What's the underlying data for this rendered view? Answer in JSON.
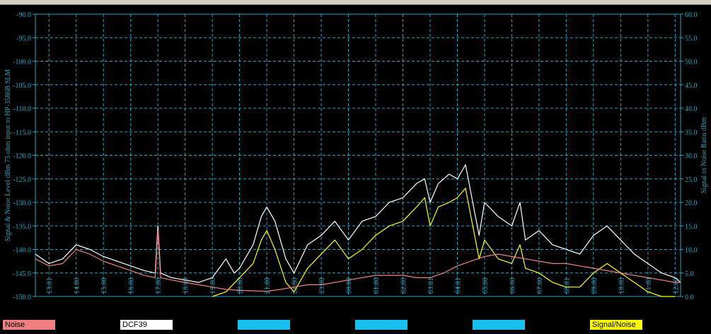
{
  "colors": {
    "background": "#000000",
    "axis": "#20a8c8",
    "grid": "#20a8c8",
    "noise": "#f08080",
    "signal": "#ffffff",
    "snr": "#ffff00",
    "blue_swatch": "#18c0f0"
  },
  "legend": {
    "noise": "Noise",
    "signal": "DCF39",
    "snr": "Signal/Noise",
    "blank1": "",
    "blank2": "",
    "blank3": ""
  },
  "chart_data": {
    "type": "line",
    "ylabel_left": "Signal & Noise Level  dBm 75 ohm input to HP-3586B SLM",
    "ylabel_right": "Signal to Noise Ratio  dBm",
    "ylim_left": [
      -150,
      -90
    ],
    "ylim_right": [
      0,
      60
    ],
    "yticks_left": [
      "-90.0",
      "-95.0",
      "-100.0",
      "-105.0",
      "-110.0",
      "-115.0",
      "-120.0",
      "-125.0",
      "-130.0",
      "-135.0",
      "-140.0",
      "-145.0",
      "-150.0"
    ],
    "yticks_right": [
      "60.0",
      "55.0",
      "50.0",
      "45.0",
      "40.0",
      "35.0",
      "30.0",
      "25.0",
      "20.0",
      "15.0",
      "10.0",
      "5.0",
      "0.0"
    ],
    "xlim": [
      12.5,
      36.2
    ],
    "xticks": [
      {
        "x": 13,
        "label": "13:01"
      },
      {
        "x": 14,
        "label": "14:00"
      },
      {
        "x": 15,
        "label": "15:00"
      },
      {
        "x": 16,
        "label": "16:00"
      },
      {
        "x": 17,
        "label": "17:00"
      },
      {
        "x": 18,
        "label": "18:00"
      },
      {
        "x": 19,
        "label": "19:00"
      },
      {
        "x": 20,
        "label": "20:00"
      },
      {
        "x": 21,
        "label": "21:00"
      },
      {
        "x": 22,
        "label": "22:00"
      },
      {
        "x": 23,
        "label": "23:00"
      },
      {
        "x": 24,
        "label": "00:00"
      },
      {
        "x": 25,
        "label": "01:00"
      },
      {
        "x": 26,
        "label": "02:00"
      },
      {
        "x": 27,
        "label": "03:01"
      },
      {
        "x": 28,
        "label": "04:01"
      },
      {
        "x": 29,
        "label": "05:00"
      },
      {
        "x": 30,
        "label": "06:00"
      },
      {
        "x": 31,
        "label": "07:00"
      },
      {
        "x": 32,
        "label": "08:01"
      },
      {
        "x": 33,
        "label": "09:00"
      },
      {
        "x": 34,
        "label": "10:00"
      },
      {
        "x": 35,
        "label": "11:00"
      },
      {
        "x": 36,
        "label": "12:00"
      }
    ],
    "grid": true,
    "series": [
      {
        "name": "Noise",
        "axis": "left",
        "x": [
          12.5,
          13,
          13.5,
          14,
          14.5,
          15,
          15.5,
          16,
          16.5,
          16.9,
          17,
          17.1,
          17.5,
          18,
          18.5,
          19,
          19.5,
          20,
          20.5,
          21,
          21.5,
          22,
          22.5,
          23,
          23.5,
          24,
          24.5,
          25,
          25.5,
          26,
          26.5,
          27,
          27.5,
          28,
          28.5,
          29,
          29.5,
          30,
          30.5,
          31,
          31.5,
          32,
          32.5,
          33,
          33.5,
          34,
          34.5,
          35,
          35.5,
          36,
          36.2
        ],
        "y": [
          -142,
          -143.5,
          -143,
          -140,
          -141,
          -142.5,
          -143.5,
          -144.5,
          -145.5,
          -146,
          -136,
          -146,
          -146.5,
          -147,
          -147.5,
          -148,
          -148.5,
          -148.7,
          -148.8,
          -148.9,
          -148.5,
          -148,
          -147.5,
          -147.5,
          -147,
          -146.5,
          -146,
          -145.5,
          -145.5,
          -145.5,
          -146,
          -146,
          -145,
          -143.5,
          -142.5,
          -141.5,
          -141,
          -141.5,
          -142,
          -142.5,
          -143,
          -143,
          -143.5,
          -144,
          -144.5,
          -145,
          -145.5,
          -146,
          -146.5,
          -147,
          -147
        ]
      },
      {
        "name": "DCF39",
        "axis": "left",
        "x": [
          12.5,
          13,
          13.5,
          14,
          14.5,
          15,
          15.5,
          16,
          16.5,
          16.9,
          17,
          17.1,
          17.5,
          18,
          18.5,
          19,
          19.5,
          19.8,
          20,
          20.5,
          20.8,
          21,
          21.3,
          21.7,
          22,
          22.5,
          23,
          23.5,
          24,
          24.5,
          25,
          25.5,
          26,
          26.5,
          26.8,
          27,
          27.3,
          27.7,
          28,
          28.3,
          28.6,
          28.8,
          29,
          29.5,
          30,
          30.3,
          30.5,
          31,
          31.5,
          32,
          32.5,
          33,
          33.5,
          34,
          34.5,
          35,
          35.5,
          36,
          36.2
        ],
        "y": [
          -141,
          -143,
          -142,
          -139,
          -140,
          -141.5,
          -142.5,
          -143.5,
          -144.5,
          -145,
          -135,
          -145,
          -146,
          -146.5,
          -147,
          -146,
          -142,
          -145,
          -144,
          -139,
          -133,
          -131,
          -134,
          -142,
          -145,
          -139,
          -137,
          -134,
          -138,
          -134,
          -133,
          -130,
          -129,
          -126,
          -125,
          -130,
          -126,
          -124,
          -125,
          -122,
          -131,
          -137,
          -130,
          -133,
          -135,
          -130,
          -138,
          -136,
          -139,
          -140,
          -141,
          -137,
          -135,
          -138,
          -141,
          -143,
          -145,
          -146,
          -147
        ]
      },
      {
        "name": "Signal/Noise",
        "axis": "right",
        "x": [
          19,
          19.5,
          20,
          20.5,
          20.8,
          21,
          21.3,
          21.7,
          22,
          22.5,
          23,
          23.5,
          24,
          24.5,
          25,
          25.5,
          26,
          26.5,
          26.8,
          27,
          27.3,
          27.7,
          28,
          28.3,
          28.6,
          28.8,
          29,
          29.5,
          30,
          30.3,
          30.5,
          31,
          31.5,
          32,
          32.5,
          33,
          33.5,
          34,
          34.5,
          35,
          35.5,
          36
        ],
        "y": [
          0,
          1,
          4,
          7,
          12,
          14,
          10,
          3,
          1,
          6,
          9,
          12,
          8,
          10,
          13,
          15,
          16,
          19,
          21,
          15,
          19,
          20,
          21,
          23,
          14,
          8,
          12,
          8,
          7,
          11,
          6,
          5,
          3,
          2,
          2,
          5,
          7,
          5,
          3,
          1,
          0,
          0
        ]
      }
    ]
  }
}
